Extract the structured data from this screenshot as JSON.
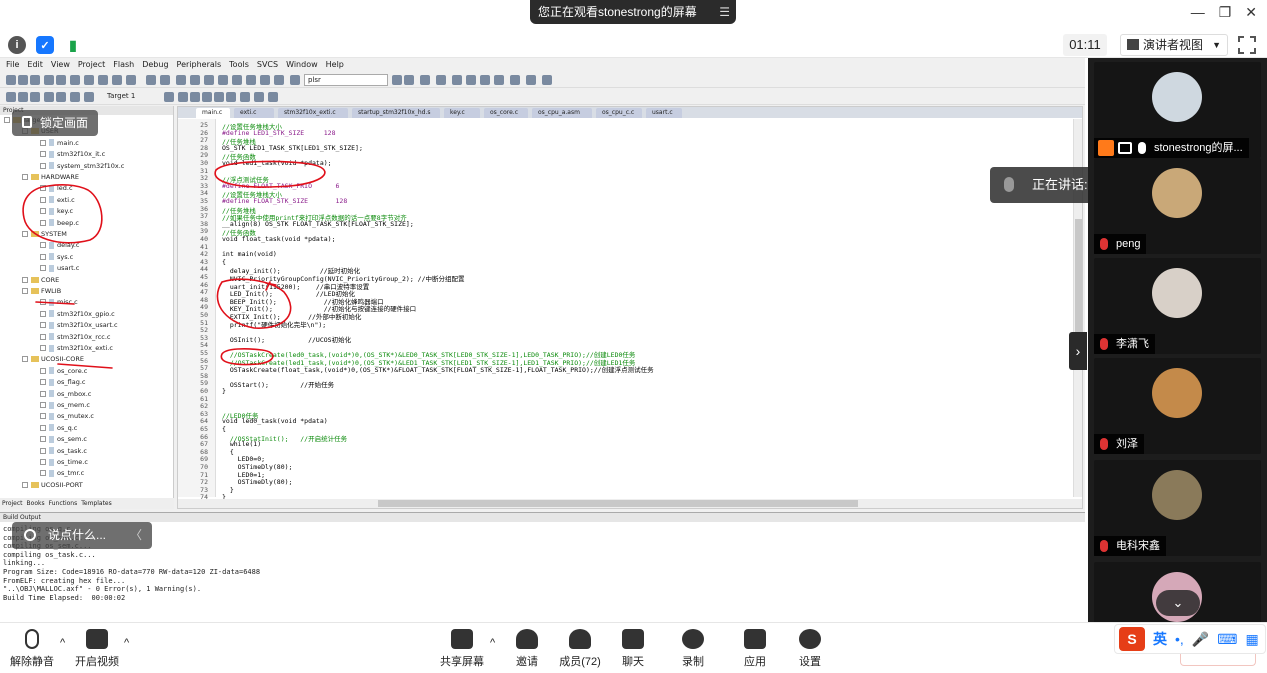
{
  "meeting": {
    "share_banner": "您正在观看stonestrong的屏幕",
    "timer": "01:11",
    "view_mode": "演讲者视图",
    "lock_screen": "锁定画面",
    "say_something": "说点什么...",
    "speaking_label": "正在讲话:"
  },
  "ide": {
    "menu": [
      "File",
      "Edit",
      "View",
      "Project",
      "Flash",
      "Debug",
      "Peripherals",
      "Tools",
      "SVCS",
      "Window",
      "Help"
    ],
    "target": "Target 1",
    "find_value": "plsr",
    "project_title": "Project",
    "tree": [
      {
        "label": "Target 1",
        "kind": "target"
      },
      {
        "label": "USER",
        "kind": "folder"
      },
      {
        "label": "main.c",
        "kind": "file"
      },
      {
        "label": "stm32f10x_it.c",
        "kind": "file"
      },
      {
        "label": "system_stm32f10x.c",
        "kind": "file"
      },
      {
        "label": "HARDWARE",
        "kind": "folder"
      },
      {
        "label": "led.c",
        "kind": "file"
      },
      {
        "label": "exti.c",
        "kind": "file"
      },
      {
        "label": "key.c",
        "kind": "file"
      },
      {
        "label": "beep.c",
        "kind": "file"
      },
      {
        "label": "SYSTEM",
        "kind": "folder"
      },
      {
        "label": "delay.c",
        "kind": "file"
      },
      {
        "label": "sys.c",
        "kind": "file"
      },
      {
        "label": "usart.c",
        "kind": "file"
      },
      {
        "label": "CORE",
        "kind": "folder"
      },
      {
        "label": "FWLIB",
        "kind": "folder"
      },
      {
        "label": "misc.c",
        "kind": "file"
      },
      {
        "label": "stm32f10x_gpio.c",
        "kind": "file"
      },
      {
        "label": "stm32f10x_usart.c",
        "kind": "file"
      },
      {
        "label": "stm32f10x_rcc.c",
        "kind": "file"
      },
      {
        "label": "stm32f10x_exti.c",
        "kind": "file"
      },
      {
        "label": "UCOSII-CORE",
        "kind": "folder"
      },
      {
        "label": "os_core.c",
        "kind": "file"
      },
      {
        "label": "os_flag.c",
        "kind": "file"
      },
      {
        "label": "os_mbox.c",
        "kind": "file"
      },
      {
        "label": "os_mem.c",
        "kind": "file"
      },
      {
        "label": "os_mutex.c",
        "kind": "file"
      },
      {
        "label": "os_q.c",
        "kind": "file"
      },
      {
        "label": "os_sem.c",
        "kind": "file"
      },
      {
        "label": "os_task.c",
        "kind": "file"
      },
      {
        "label": "os_time.c",
        "kind": "file"
      },
      {
        "label": "os_tmr.c",
        "kind": "file"
      },
      {
        "label": "UCOSII-PORT",
        "kind": "folder"
      }
    ],
    "project_tabs": [
      "Project",
      "Books",
      "Functions",
      "Templates"
    ],
    "file_tabs": [
      "main.c",
      "exti.c",
      "stm32f10x_exti.c",
      "startup_stm32f10x_hd.s",
      "key.c",
      "os_core.c",
      "os_cpu_a.asm",
      "os_cpu_c.c",
      "usart.c"
    ],
    "code": [
      {
        "n": "25",
        "t": "//设置任务堆栈大小",
        "c": "green"
      },
      {
        "n": "26",
        "t": "#define LED1_STK_SIZE     128",
        "c": "purple"
      },
      {
        "n": "27",
        "t": "//任务堆栈",
        "c": "green"
      },
      {
        "n": "28",
        "t": "OS_STK LED1_TASK_STK[LED1_STK_SIZE];",
        "c": ""
      },
      {
        "n": "29",
        "t": "//任务函数",
        "c": "green"
      },
      {
        "n": "30",
        "t": "void led1_task(void *pdata);",
        "c": ""
      },
      {
        "n": "31",
        "t": "",
        "c": ""
      },
      {
        "n": "32",
        "t": "//浮点测试任务",
        "c": "green"
      },
      {
        "n": "33",
        "t": "#define FLOAT_TASK_PRIO      6",
        "c": "purple"
      },
      {
        "n": "34",
        "t": "//设置任务堆栈大小",
        "c": "green"
      },
      {
        "n": "35",
        "t": "#define FLOAT_STK_SIZE       128",
        "c": "purple"
      },
      {
        "n": "36",
        "t": "//任务堆栈",
        "c": "green"
      },
      {
        "n": "37",
        "t": "//如果任务中使用printf来打印浮点数据的话一点要8字节对齐",
        "c": "green"
      },
      {
        "n": "38",
        "t": "__align(8) OS_STK FLOAT_TASK_STK[FLOAT_STK_SIZE];",
        "c": ""
      },
      {
        "n": "39",
        "t": "//任务函数",
        "c": "green"
      },
      {
        "n": "40",
        "t": "void float_task(void *pdata);",
        "c": ""
      },
      {
        "n": "41",
        "t": "",
        "c": ""
      },
      {
        "n": "42",
        "t": "int main(void)",
        "c": ""
      },
      {
        "n": "43",
        "t": "{",
        "c": ""
      },
      {
        "n": "44",
        "t": "  delay_init();          //延时初始化",
        "c": ""
      },
      {
        "n": "45",
        "t": "  NVIC_PriorityGroupConfig(NVIC_PriorityGroup_2); //中断分组配置",
        "c": ""
      },
      {
        "n": "46",
        "t": "  uart_init(115200);    //串口波特率设置",
        "c": ""
      },
      {
        "n": "47",
        "t": "  LED_Init();           //LED初始化",
        "c": ""
      },
      {
        "n": "48",
        "t": "  BEEP_Init();            //初始化蜂鸣器端口",
        "c": ""
      },
      {
        "n": "49",
        "t": "  KEY_Init();             //初始化与按键连接的硬件接口",
        "c": ""
      },
      {
        "n": "50",
        "t": "  EXTIX_Init();       //外部中断初始化",
        "c": ""
      },
      {
        "n": "51",
        "t": "  printf(\"硬件初始化完毕\\n\");",
        "c": ""
      },
      {
        "n": "52",
        "t": "",
        "c": ""
      },
      {
        "n": "53",
        "t": "  OSInit();           //UCOS初始化",
        "c": ""
      },
      {
        "n": "54",
        "t": "",
        "c": ""
      },
      {
        "n": "55",
        "t": "  //OSTaskCreate(led0_task,(void*)0,(OS_STK*)&LED0_TASK_STK[LED0_STK_SIZE-1],LED0_TASK_PRIO);//创建LED0任务",
        "c": "green"
      },
      {
        "n": "56",
        "t": "  //OSTaskCreate(led1_task,(void*)0,(OS_STK*)&LED1_TASK_STK[LED1_STK_SIZE-1],LED1_TASK_PRIO);//创建LED1任务",
        "c": "green"
      },
      {
        "n": "57",
        "t": "  OSTaskCreate(float_task,(void*)0,(OS_STK*)&FLOAT_TASK_STK[FLOAT_STK_SIZE-1],FLOAT_TASK_PRIO);//创建浮点测试任务",
        "c": ""
      },
      {
        "n": "58",
        "t": "",
        "c": ""
      },
      {
        "n": "59",
        "t": "  OSStart();        //开始任务",
        "c": ""
      },
      {
        "n": "60",
        "t": "}",
        "c": ""
      },
      {
        "n": "61",
        "t": "",
        "c": ""
      },
      {
        "n": "62",
        "t": "",
        "c": ""
      },
      {
        "n": "63",
        "t": "//LED0任务",
        "c": "green"
      },
      {
        "n": "64",
        "t": "void led0_task(void *pdata)",
        "c": ""
      },
      {
        "n": "65",
        "t": "{",
        "c": ""
      },
      {
        "n": "66",
        "t": "  //OSStatInit();   //开启统计任务",
        "c": "green"
      },
      {
        "n": "67",
        "t": "  while(1)",
        "c": ""
      },
      {
        "n": "68",
        "t": "  {",
        "c": ""
      },
      {
        "n": "69",
        "t": "    LED0=0;",
        "c": ""
      },
      {
        "n": "70",
        "t": "    OSTimeDly(80);",
        "c": ""
      },
      {
        "n": "71",
        "t": "    LED0=1;",
        "c": ""
      },
      {
        "n": "72",
        "t": "    OSTimeDly(80);",
        "c": ""
      },
      {
        "n": "73",
        "t": "  }",
        "c": ""
      },
      {
        "n": "74",
        "t": "}",
        "c": ""
      }
    ],
    "build_title": "Build Output",
    "build_lines": [
      "compiling os_q.c...",
      "compiling os_sem.c...",
      "compiling os_sem.c...",
      "compiling os_task.c...",
      "linking...",
      "Program Size: Code=18916 RO-data=770 RW-data=120 ZI-data=6488",
      "FromELF: creating hex file...",
      "\"..\\OBJ\\MALLOC.axf\" - 0 Error(s), 1 Warning(s).",
      "Build Time Elapsed:  00:00:02"
    ]
  },
  "participants": [
    {
      "name": "stonestrong的屏...",
      "host": true
    },
    {
      "name": "peng",
      "host": false
    },
    {
      "name": "李潇飞",
      "host": false
    },
    {
      "name": "刘泽",
      "host": false
    },
    {
      "name": "电科宋鑫",
      "host": false
    },
    {
      "name": "",
      "host": false
    }
  ],
  "toolbar": {
    "unmute": "解除静音",
    "video": "开启视频",
    "share": "共享屏幕",
    "invite": "邀请",
    "members": "成员(72)",
    "chat": "聊天",
    "record": "录制",
    "apps": "应用",
    "settings": "设置"
  },
  "ime": {
    "lang": "英"
  },
  "colors": {
    "annotation": "#e0101a",
    "accent": "#1677ff"
  }
}
